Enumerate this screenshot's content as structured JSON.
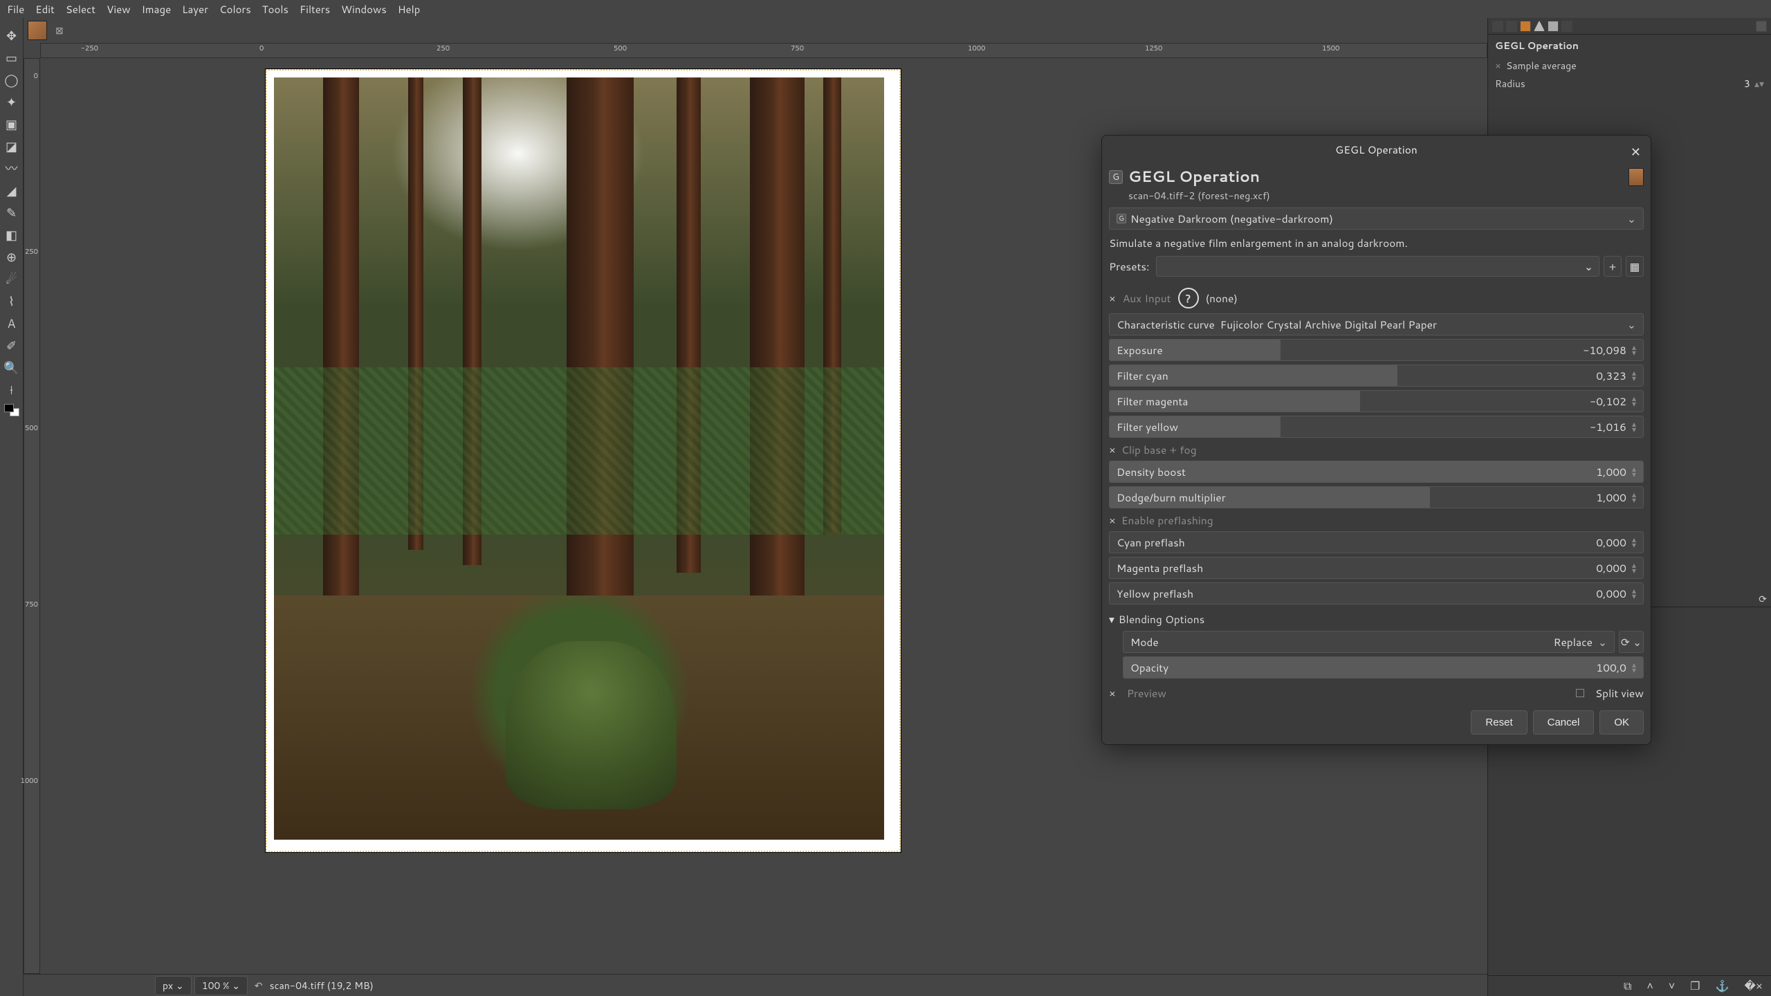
{
  "menu": {
    "file": "File",
    "edit": "Edit",
    "select": "Select",
    "view": "View",
    "image": "Image",
    "layer": "Layer",
    "colors": "Colors",
    "tools": "Tools",
    "filters": "Filters",
    "windows": "Windows",
    "help": "Help"
  },
  "ruler_h": [
    "-250",
    "0",
    "250",
    "500",
    "750",
    "1000",
    "1250",
    "1500"
  ],
  "ruler_v": [
    "0",
    "250",
    "500",
    "750",
    "1000"
  ],
  "status": {
    "unit": "px",
    "zoom": "100 %",
    "file": "scan-04.tiff (19,2 MB)"
  },
  "rightdock": {
    "title": "GEGL Operation",
    "sample_avg_label": "Sample average",
    "radius_label": "Radius",
    "radius_value": "3"
  },
  "dialog": {
    "title": "GEGL Operation",
    "heading": "GEGL Operation",
    "subtitle": "scan-04.tiff-2 (forest-neg.xcf)",
    "operation_select": "Negative Darkroom (negative-darkroom)",
    "description": "Simulate a negative film enlargement in an analog darkroom.",
    "presets_label": "Presets:",
    "aux_label": "Aux Input",
    "aux_value": "(none)",
    "curve_label": "Characteristic curve",
    "curve_value": "Fujicolor Crystal Archive Digital Pearl Paper",
    "sliders": {
      "exposure": {
        "label": "Exposure",
        "value": "-10,098",
        "fill": 32
      },
      "filter_cyan": {
        "label": "Filter cyan",
        "value": "0,323",
        "fill": 54
      },
      "filter_magenta": {
        "label": "Filter magenta",
        "value": "-0,102",
        "fill": 47
      },
      "filter_yellow": {
        "label": "Filter yellow",
        "value": "-1,016",
        "fill": 32
      },
      "density_boost": {
        "label": "Density boost",
        "value": "1,000",
        "fill": 100
      },
      "dodge_burn": {
        "label": "Dodge/burn multiplier",
        "value": "1,000",
        "fill": 60
      },
      "cyan_preflash": {
        "label": "Cyan preflash",
        "value": "0,000",
        "fill": 0
      },
      "magenta_preflash": {
        "label": "Magenta preflash",
        "value": "0,000",
        "fill": 0
      },
      "yellow_preflash": {
        "label": "Yellow preflash",
        "value": "0,000",
        "fill": 0
      },
      "opacity": {
        "label": "Opacity",
        "value": "100,0",
        "fill": 100
      }
    },
    "clip_label": "Clip base + fog",
    "preflash_label": "Enable preflashing",
    "blending_label": "Blending Options",
    "mode_label": "Mode",
    "mode_value": "Replace",
    "preview_label": "Preview",
    "splitview_label": "Split view",
    "buttons": {
      "reset": "Reset",
      "cancel": "Cancel",
      "ok": "OK"
    }
  }
}
